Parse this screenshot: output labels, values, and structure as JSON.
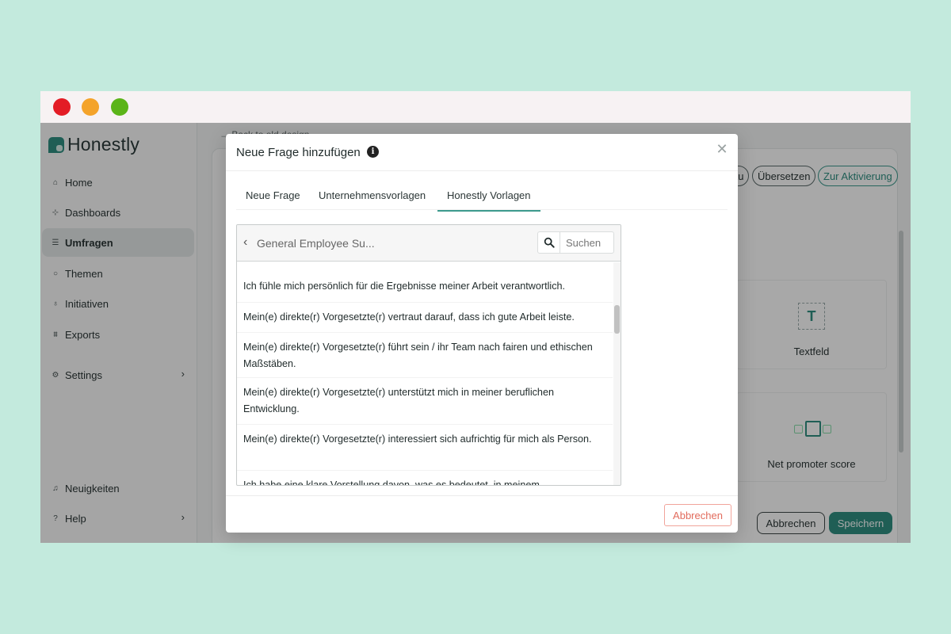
{
  "brand": {
    "name": "Honestly"
  },
  "sidebar": {
    "items": [
      {
        "label": "Home",
        "icon": "home-icon"
      },
      {
        "label": "Dashboards",
        "icon": "dashboard-icon"
      },
      {
        "label": "Umfragen",
        "icon": "survey-icon",
        "active": true
      },
      {
        "label": "Themen",
        "icon": "chat-icon"
      },
      {
        "label": "Initiativen",
        "icon": "lightbulb-icon"
      },
      {
        "label": "Exports",
        "icon": "export-icon"
      },
      {
        "label": "Settings",
        "icon": "gear-icon"
      }
    ],
    "bottom": [
      {
        "label": "Neuigkeiten",
        "icon": "bell-icon"
      },
      {
        "label": "Help",
        "icon": "help-icon"
      }
    ]
  },
  "main": {
    "back_link": "Back to old design",
    "header_buttons": {
      "preview": "au",
      "translate": "Übersetzen",
      "activate": "Zur Aktivierung"
    },
    "widgets": {
      "textfield": "Textfeld",
      "nps": "Net promoter score"
    },
    "footer": {
      "cancel": "Abbrechen",
      "save": "Speichern"
    }
  },
  "modal": {
    "title": "Neue Frage hinzufügen",
    "tabs": [
      "Neue Frage",
      "Unternehmensvorlagen",
      "Honestly Vorlagen"
    ],
    "active_tab": 2,
    "template": {
      "title": "General Employee Su...",
      "search_placeholder": "Suchen",
      "items": [
        "Ich fühle mich persönlich für die Ergebnisse meiner Arbeit verantwortlich.",
        "Mein(e) direkte(r) Vorgesetzte(r) vertraut darauf, dass ich gute Arbeit leiste.",
        "Mein(e) direkte(r) Vorgesetzte(r) führt sein / ihr Team nach fairen und ethischen Maßstäben.",
        "Mein(e) direkte(r) Vorgesetzte(r) unterstützt mich in meiner beruflichen Entwicklung.",
        "Mein(e) direkte(r) Vorgesetzte(r) interessiert sich aufrichtig für mich als Person.",
        "Ich habe eine klare Vorstellung davon, was es bedeutet, in meinem"
      ]
    },
    "cancel_label": "Abbrechen"
  },
  "colors": {
    "accent": "#2f8f82",
    "cancel": "#e26b5c",
    "background": "#c3eadd"
  }
}
